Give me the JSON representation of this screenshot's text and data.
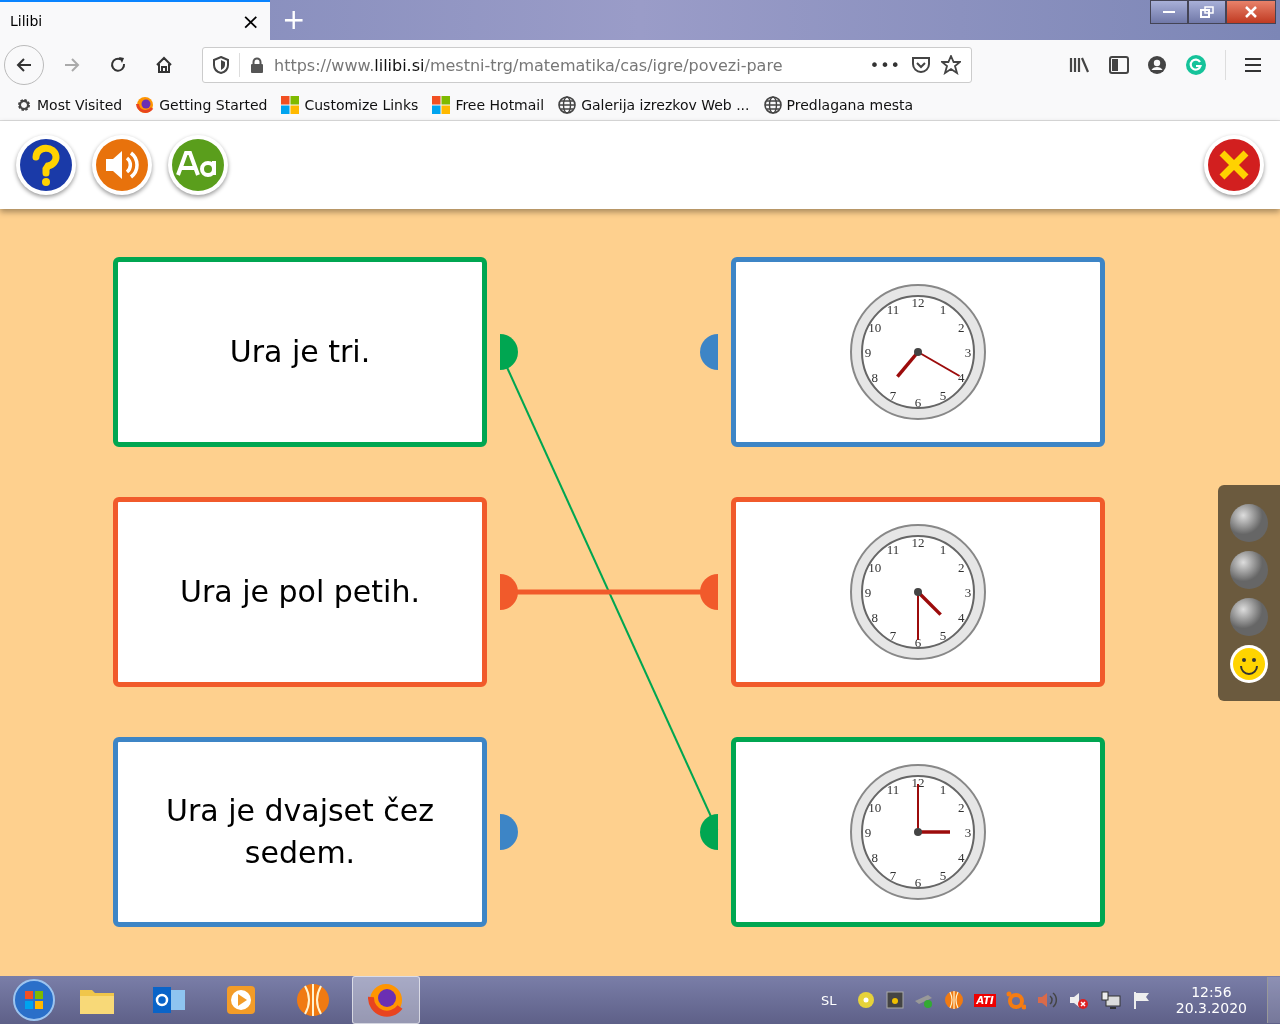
{
  "browser": {
    "tab": {
      "title": "Lilibi",
      "close": "×"
    },
    "new_tab": "+",
    "url": {
      "prefix": "https://www.",
      "host": "lilibi.si",
      "path": "/mestni-trg/matematika/cas/igre/povezi-pare"
    },
    "page_actions": "•••",
    "bookmarks": [
      {
        "label": "Most Visited",
        "kind": "gear"
      },
      {
        "label": "Getting Started",
        "kind": "firefox"
      },
      {
        "label": "Customize Links",
        "kind": "windows"
      },
      {
        "label": "Free Hotmail",
        "kind": "windows"
      },
      {
        "label": "Galerija izrezkov Web ...",
        "kind": "globe"
      },
      {
        "label": "Predlagana mesta",
        "kind": "globe"
      }
    ]
  },
  "left_cards": [
    {
      "text": "Ura je tri.",
      "color": "#00a651",
      "connected": true
    },
    {
      "text": "Ura je pol petih.",
      "color": "#f15a2b",
      "connected": true
    },
    {
      "text": "Ura je dvajset čez sedem.",
      "color": "#3d85c6",
      "connected": false
    }
  ],
  "right_cards": [
    {
      "color": "#3d85c6",
      "numerals": [
        "12",
        "1",
        "2",
        "3",
        "4",
        "5",
        "6",
        "7",
        "8",
        "9",
        "10",
        "11"
      ]
    },
    {
      "color": "#f15a2b",
      "numerals": [
        "12",
        "1",
        "2",
        "3",
        "4",
        "5",
        "6",
        "7",
        "8",
        "9",
        "10",
        "11"
      ]
    },
    {
      "color": "#00a651",
      "numerals": [
        "12",
        "1",
        "2",
        "3",
        "4",
        "5",
        "6",
        "7",
        "8",
        "9",
        "10",
        "11"
      ]
    }
  ],
  "progress": [
    {
      "done": false
    },
    {
      "done": false
    },
    {
      "done": false
    },
    {
      "done": true
    }
  ],
  "taskbar": {
    "apps": [
      {
        "kind": "folder",
        "selected": false
      },
      {
        "kind": "outlook",
        "selected": false
      },
      {
        "kind": "player",
        "selected": false
      },
      {
        "kind": "ball",
        "selected": false
      },
      {
        "kind": "firefox",
        "selected": true
      }
    ],
    "language": "SL",
    "ati": "ATI",
    "time": "12:56",
    "date": "20.3.2020"
  }
}
